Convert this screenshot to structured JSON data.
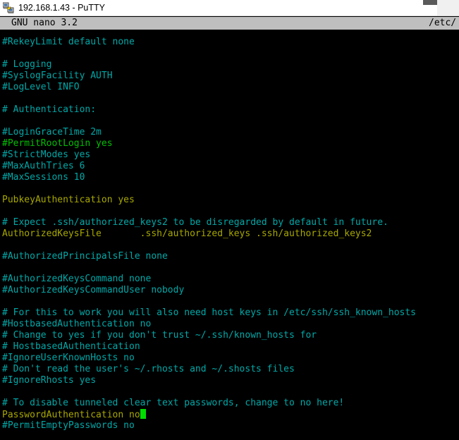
{
  "window": {
    "title": "192.168.1.43 - PuTTY",
    "icon": "putty-network-icon"
  },
  "nano": {
    "version_label": "GNU nano 3.2",
    "path_label": "/etc/"
  },
  "colors": {
    "background": "#000000",
    "comment": "#00a8a8",
    "highlight_green": "#00c000",
    "directive_value": "#a8a800",
    "cursor": "#00dd00",
    "header_bar": "#bfbfbf",
    "titlebar": "#ffffff"
  },
  "editor": {
    "lines": [
      {
        "text": "#RekeyLimit default none",
        "style": "comment"
      },
      {
        "text": "",
        "style": "comment"
      },
      {
        "text": "# Logging",
        "style": "comment"
      },
      {
        "text": "#SyslogFacility AUTH",
        "style": "comment"
      },
      {
        "text": "#LogLevel INFO",
        "style": "comment"
      },
      {
        "text": "",
        "style": "comment"
      },
      {
        "text": "# Authentication:",
        "style": "comment"
      },
      {
        "text": "",
        "style": "comment"
      },
      {
        "text": "#LoginGraceTime 2m",
        "style": "comment"
      },
      {
        "text": "#PermitRootLogin yes",
        "style": "green"
      },
      {
        "text": "#StrictModes yes",
        "style": "comment"
      },
      {
        "text": "#MaxAuthTries 6",
        "style": "comment"
      },
      {
        "text": "#MaxSessions 10",
        "style": "comment"
      },
      {
        "text": "",
        "style": "comment"
      },
      {
        "text": "PubkeyAuthentication yes",
        "style": "value"
      },
      {
        "text": "",
        "style": "comment"
      },
      {
        "text": "# Expect .ssh/authorized_keys2 to be disregarded by default in future.",
        "style": "comment"
      },
      {
        "text": "AuthorizedKeysFile       .ssh/authorized_keys .ssh/authorized_keys2",
        "style": "value"
      },
      {
        "text": "",
        "style": "comment"
      },
      {
        "text": "#AuthorizedPrincipalsFile none",
        "style": "comment"
      },
      {
        "text": "",
        "style": "comment"
      },
      {
        "text": "#AuthorizedKeysCommand none",
        "style": "comment"
      },
      {
        "text": "#AuthorizedKeysCommandUser nobody",
        "style": "comment"
      },
      {
        "text": "",
        "style": "comment"
      },
      {
        "text": "# For this to work you will also need host keys in /etc/ssh/ssh_known_hosts",
        "style": "comment"
      },
      {
        "text": "#HostbasedAuthentication no",
        "style": "comment"
      },
      {
        "text": "# Change to yes if you don't trust ~/.ssh/known_hosts for",
        "style": "comment"
      },
      {
        "text": "# HostbasedAuthentication",
        "style": "comment"
      },
      {
        "text": "#IgnoreUserKnownHosts no",
        "style": "comment"
      },
      {
        "text": "# Don't read the user's ~/.rhosts and ~/.shosts files",
        "style": "comment"
      },
      {
        "text": "#IgnoreRhosts yes",
        "style": "comment"
      },
      {
        "text": "",
        "style": "comment"
      },
      {
        "text": "# To disable tunneled clear text passwords, change to no here!",
        "style": "comment"
      },
      {
        "text": "PasswordAuthentication no",
        "style": "value",
        "cursor_after": true
      },
      {
        "text": "#PermitEmptyPasswords no",
        "style": "comment"
      }
    ]
  }
}
